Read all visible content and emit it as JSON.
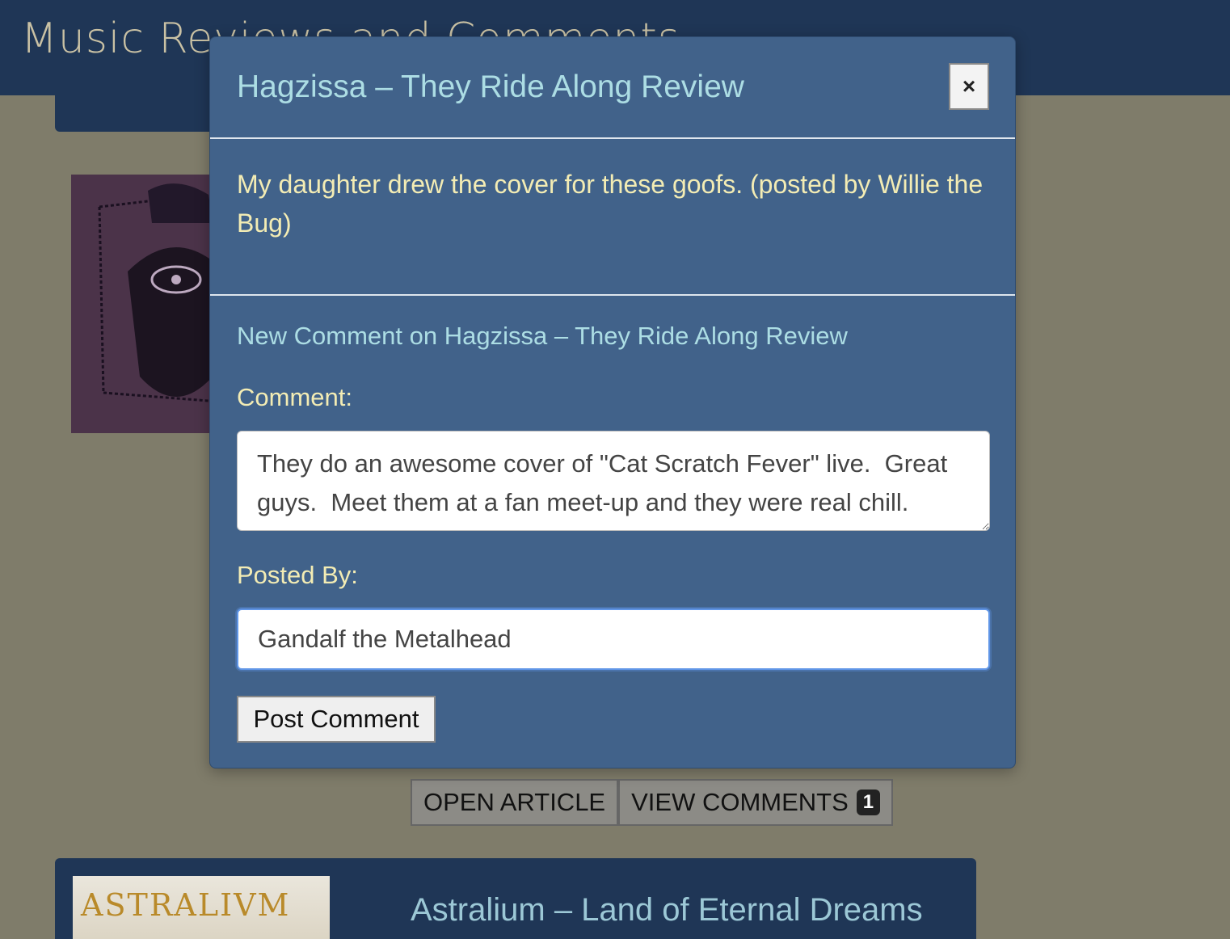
{
  "site": {
    "title": "Music Reviews and Comments"
  },
  "background_cards": [
    {
      "buttons": {
        "open_article": "OPEN ARTICLE",
        "view_comments": "VIEW COMMENTS",
        "comment_count": "1"
      }
    },
    {
      "cover_text": "ASTRALIVM",
      "title": "Astralium – Land of Eternal Dreams"
    }
  ],
  "modal": {
    "title": "Hagzissa – They Ride Along Review",
    "close_label": "×",
    "existing_comment": "My daughter drew the cover for these goofs. (posted by Willie the Bug)",
    "form": {
      "heading": "New Comment on Hagzissa – They Ride Along Review",
      "comment_label": "Comment:",
      "comment_value": "They do an awesome cover of \"Cat Scratch Fever\" live.  Great guys.  Meet them at a fan meet-up and they were real chill.",
      "posted_by_label": "Posted By:",
      "posted_by_value": "Gandalf the Metalhead",
      "submit_label": "Post Comment"
    }
  },
  "colors": {
    "page_background": "#7f7c6a",
    "header_background": "#1f3656",
    "modal_background": "#41628a",
    "title_text": "#acdde4",
    "body_text": "#f3ecb4",
    "focus_ring": "#5f95e6"
  }
}
